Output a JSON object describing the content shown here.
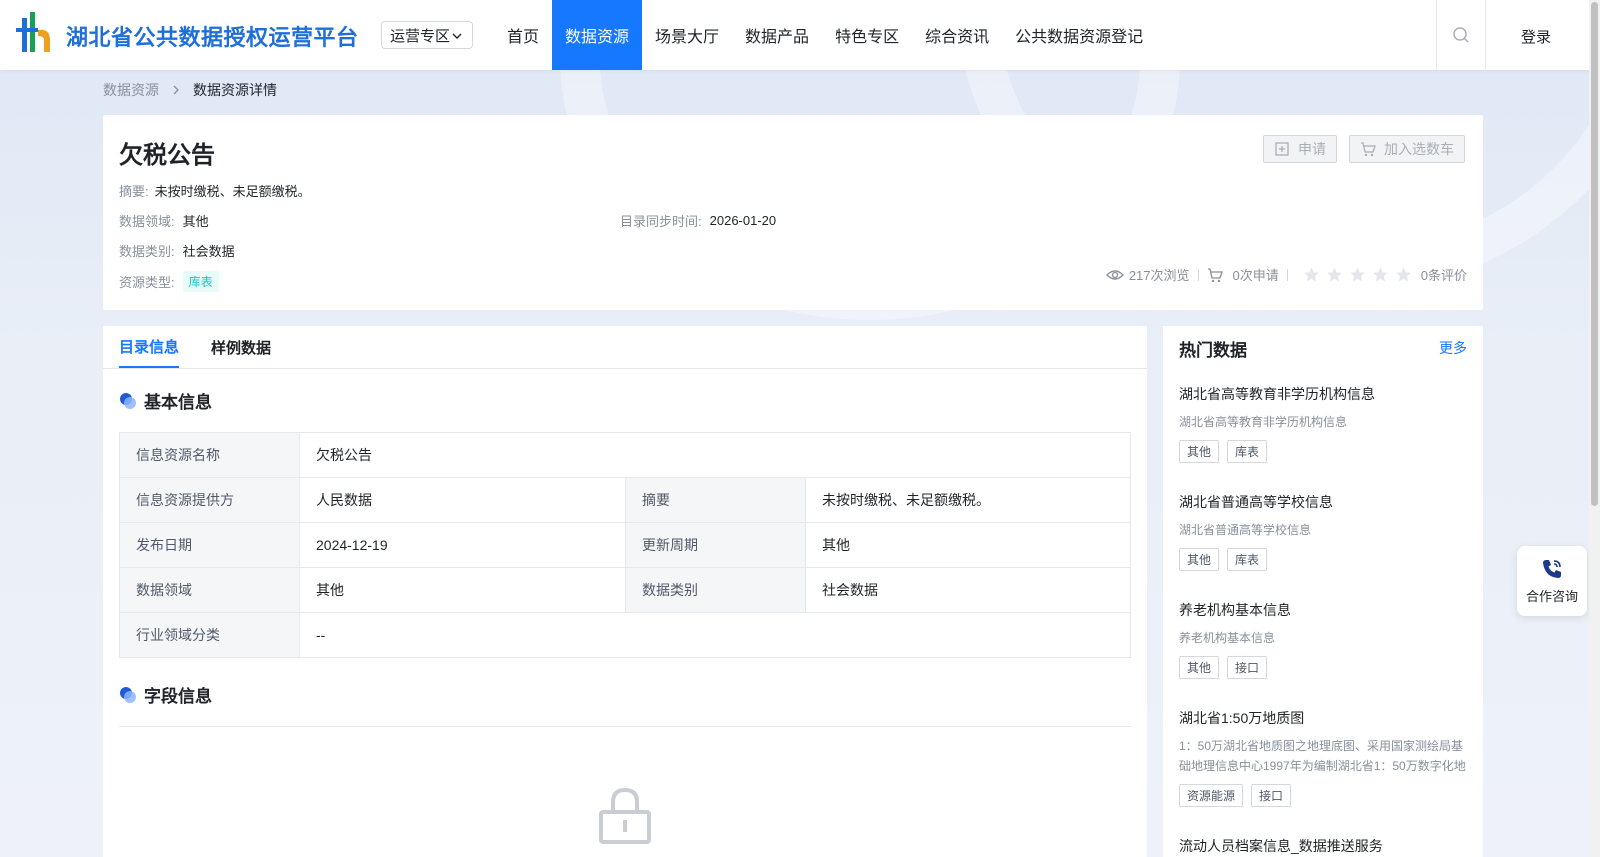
{
  "header": {
    "site_title": "湖北省公共数据授权运营平台",
    "zone_select": "运营专区",
    "nav": [
      "首页",
      "数据资源",
      "场景大厅",
      "数据产品",
      "特色专区",
      "综合资讯",
      "公共数据资源登记"
    ],
    "active_nav": "数据资源",
    "login": "登录",
    "accent_color": "#1677ff"
  },
  "breadcrumb": {
    "parent": "数据资源",
    "current": "数据资源详情"
  },
  "detail": {
    "title": "欠税公告",
    "summary_label": "摘要:",
    "summary": "未按时缴税、未足额缴税。",
    "domain_label": "数据领域:",
    "domain": "其他",
    "sync_label": "目录同步时间:",
    "sync_time": "2026-01-20",
    "category_label": "数据类别:",
    "category": "社会数据",
    "resource_type_label": "资源类型:",
    "resource_type": "库表",
    "apply_button": "申请",
    "cart_button": "加入选数车",
    "views": "217次浏览",
    "applications": "0次申请",
    "rating_stars": 0,
    "reviews": "0条评价"
  },
  "tabs": [
    "目录信息",
    "样例数据"
  ],
  "basic_info": {
    "section_title": "基本信息",
    "rows": [
      [
        {
          "k": "信息资源名称",
          "v": "欠税公告"
        }
      ],
      [
        {
          "k": "信息资源提供方",
          "v": "人民数据"
        },
        {
          "k": "摘要",
          "v": "未按时缴税、未足额缴税。"
        }
      ],
      [
        {
          "k": "发布日期",
          "v": "2024-12-19"
        },
        {
          "k": "更新周期",
          "v": "其他"
        }
      ],
      [
        {
          "k": "数据领域",
          "v": "其他"
        },
        {
          "k": "数据类别",
          "v": "社会数据"
        }
      ],
      [
        {
          "k": "行业领域分类",
          "v": "--"
        }
      ]
    ]
  },
  "field_info": {
    "section_title": "字段信息"
  },
  "hot": {
    "title": "热门数据",
    "more": "更多",
    "items": [
      {
        "name": "湖北省高等教育非学历机构信息",
        "desc": "湖北省高等教育非学历机构信息",
        "tags": [
          "其他",
          "库表"
        ]
      },
      {
        "name": "湖北省普通高等学校信息",
        "desc": "湖北省普通高等学校信息",
        "tags": [
          "其他",
          "库表"
        ]
      },
      {
        "name": "养老机构基本信息",
        "desc": "养老机构基本信息",
        "tags": [
          "其他",
          "接口"
        ]
      },
      {
        "name": "湖北省1:50万地质图",
        "desc": "1：50万湖北省地质图之地理底图、采用国家测绘局基础地理信息中心1997年为编制湖北省1：50万数字化地",
        "tags": [
          "资源能源",
          "接口"
        ]
      },
      {
        "name": "流动人员档案信息_数据推送服务",
        "desc": "",
        "tags": []
      }
    ]
  },
  "consult": {
    "label": "合作咨询"
  }
}
